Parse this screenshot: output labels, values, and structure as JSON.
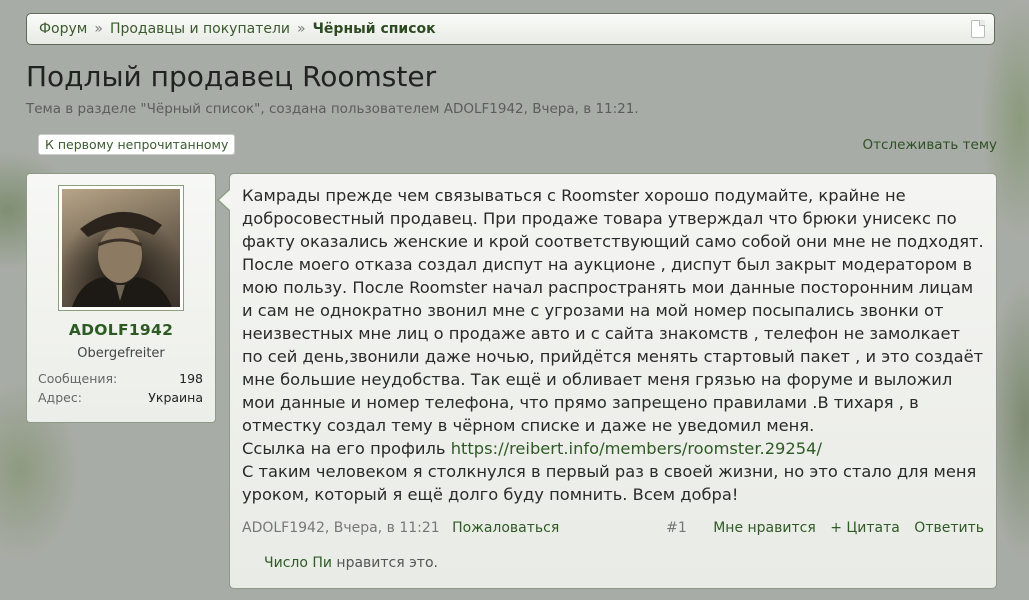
{
  "breadcrumb": {
    "items": [
      "Форум",
      "Продавцы и покупатели"
    ],
    "separator": "»",
    "current": "Чёрный список"
  },
  "thread": {
    "title": "Подлый продавец Roomster",
    "meta": "Тема в разделе \"Чёрный список\", создана пользователем ADOLF1942, Вчера, в 11:21."
  },
  "controls": {
    "first_unread": "К первому непрочитанному",
    "watch": "Отслеживать тему"
  },
  "user": {
    "name": "ADOLF1942",
    "rank": "Obergefreiter",
    "stats": [
      {
        "label": "Сообщения:",
        "value": "198"
      },
      {
        "label": "Адрес:",
        "value": "Украина"
      }
    ]
  },
  "post": {
    "text": "Камрады прежде чем связываться с Roomster хорошо подумайте, крайне не\nдобросовестный продавец. При продаже товара утверждал что брюки унисекс по\nфакту оказались женские и крой соответствующий само собой они мне не подходят.\nПосле моего отказа создал диспут на аукционе , диспут был закрыт модератором в\nмою пользу. После Roomster начал распространять мои данные посторонним лицам\nи сам не однократно звонил мне с угрозами на мой номер посыпались звонки от\nнеизвестных мне лиц о продаже авто и с сайта знакомств , телефон не замолкает\nпо сей день,звонили даже ночью, прийдётся менять стартовый пакет , и это создаёт\nмне большие неудобства. Так ещё и обливает меня грязью на форуме и выложил\nмои данные и номер телефона, что прямо запрещено правилами .В тихаря , в\nотместку создал тему в чёрном списке и даже не уведомил меня.",
    "link_prefix": "Ссылка на его профиль ",
    "link": "https://reibert.info/members/roomster.29254/",
    "closing": "С таким человеком я столкнулся в первый раз в своей жизни, но это стало для меня\nуроком, который я ещё долго буду помнить. Всем добра!",
    "author": "ADOLF1942",
    "date": "Вчера, в 11:21",
    "report": "Пожаловаться",
    "number": "#1",
    "like": "Мне нравится",
    "quote": "+ Цитата",
    "reply": "Ответить",
    "likes_user": "Число Пи",
    "likes_suffix": " нравится это."
  },
  "colors": {
    "link": "#2f5a25",
    "username": "#2d5a23",
    "card_border": "#8e9a86"
  }
}
